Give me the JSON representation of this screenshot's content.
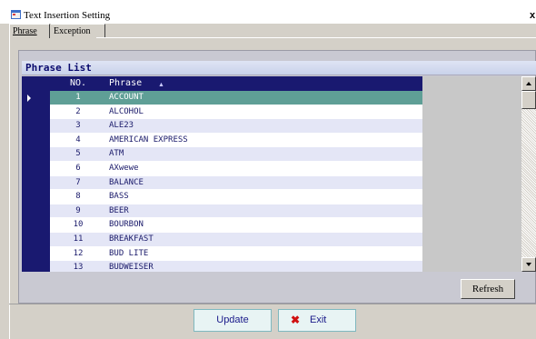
{
  "window": {
    "title": "Text Insertion Setting",
    "close_glyph": "x",
    "icon": "app-window-icon"
  },
  "tabs": [
    {
      "label": "Phrase",
      "active": true
    },
    {
      "label": "Exception",
      "active": false
    }
  ],
  "grid": {
    "caption": "Phrase List",
    "columns": [
      "NO.",
      "Phrase"
    ],
    "sort_indicator": "▲",
    "selected_index": 0,
    "rows": [
      {
        "no": "1",
        "phrase": "ACCOUNT"
      },
      {
        "no": "2",
        "phrase": "ALCOHOL"
      },
      {
        "no": "3",
        "phrase": "ALE23"
      },
      {
        "no": "4",
        "phrase": "AMERICAN EXPRESS"
      },
      {
        "no": "5",
        "phrase": "ATM"
      },
      {
        "no": "6",
        "phrase": "AXwewe"
      },
      {
        "no": "7",
        "phrase": "BALANCE"
      },
      {
        "no": "8",
        "phrase": "BASS"
      },
      {
        "no": "9",
        "phrase": "BEER"
      },
      {
        "no": "10",
        "phrase": "BOURBON"
      },
      {
        "no": "11",
        "phrase": "BREAKFAST"
      },
      {
        "no": "12",
        "phrase": "BUD LITE"
      },
      {
        "no": "13",
        "phrase": "BUDWEISER"
      }
    ]
  },
  "buttons": {
    "refresh": "Refresh",
    "update": "Update",
    "exit": "Exit"
  },
  "colors": {
    "header_bg": "#191970",
    "selected_row": "#5f9f96",
    "odd_row": "#e4e6f6",
    "exit_icon": "#d01010"
  }
}
